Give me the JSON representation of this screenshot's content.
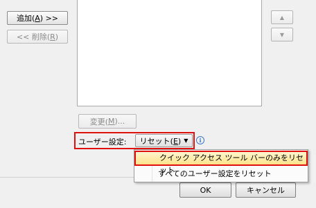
{
  "left_buttons": {
    "add": {
      "prefix": "追加(",
      "mnemonic": "A",
      "suffix": ") >>"
    },
    "remove": {
      "prefix": "<< 削除(",
      "mnemonic": "R",
      "suffix": ")"
    }
  },
  "modify": {
    "prefix": "変更(",
    "mnemonic": "M",
    "suffix": ")..."
  },
  "user_settings": {
    "label": "ユーザー設定:",
    "reset": {
      "prefix": "リセット(",
      "mnemonic": "E",
      "suffix": ")"
    }
  },
  "menu": {
    "items": [
      {
        "label": "クイック アクセス ツール バーのみをリセット"
      },
      {
        "label": "すべてのユーザー設定をリセット"
      }
    ]
  },
  "dialog_buttons": {
    "ok": "OK",
    "cancel": "キャンセル"
  },
  "colors": {
    "highlight_border": "#e01010",
    "menu_highlight": "#ffe28a",
    "info_icon": "#3a78c6"
  }
}
